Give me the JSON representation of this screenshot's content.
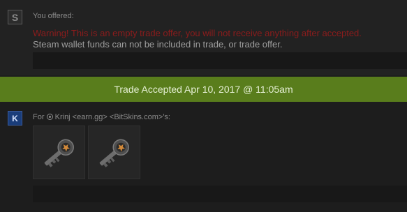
{
  "offer": {
    "avatar_letter": "S",
    "label": "You offered:",
    "warning": "Warning! This is an empty trade offer, you will not receive anything after accepted.",
    "wallet_note": "Steam wallet funds can not be included in trade, or trade offer."
  },
  "banner": {
    "text": "Trade Accepted Apr 10, 2017 @ 11:05am",
    "color": "#597d1c"
  },
  "partner": {
    "avatar_letter": "K",
    "label_prefix": "For",
    "label_rest": "Krinj <earn.gg> <BitSkins.com>'s:",
    "items": [
      {
        "icon": "case-key-icon"
      },
      {
        "icon": "case-key-icon"
      }
    ]
  }
}
